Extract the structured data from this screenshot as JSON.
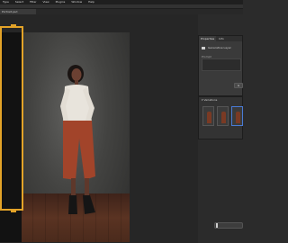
{
  "menu": {
    "items": [
      "Type",
      "Select",
      "Filter",
      "View",
      "Plugins",
      "Window",
      "Help"
    ]
  },
  "document": {
    "tab_label": "Portrait.psd"
  },
  "properties_panel": {
    "tabs": [
      "Properties",
      "Info"
    ],
    "layer_label": "Generative Layer",
    "prompt_label": "Prompt",
    "generate_label": "G"
  },
  "variations_panel": {
    "title": "Variations",
    "thumbnails": 3
  },
  "colors": {
    "selection": "#e3a328",
    "background": "#262626",
    "panel": "#3a3a3a",
    "accent": "#4a7bd6"
  }
}
